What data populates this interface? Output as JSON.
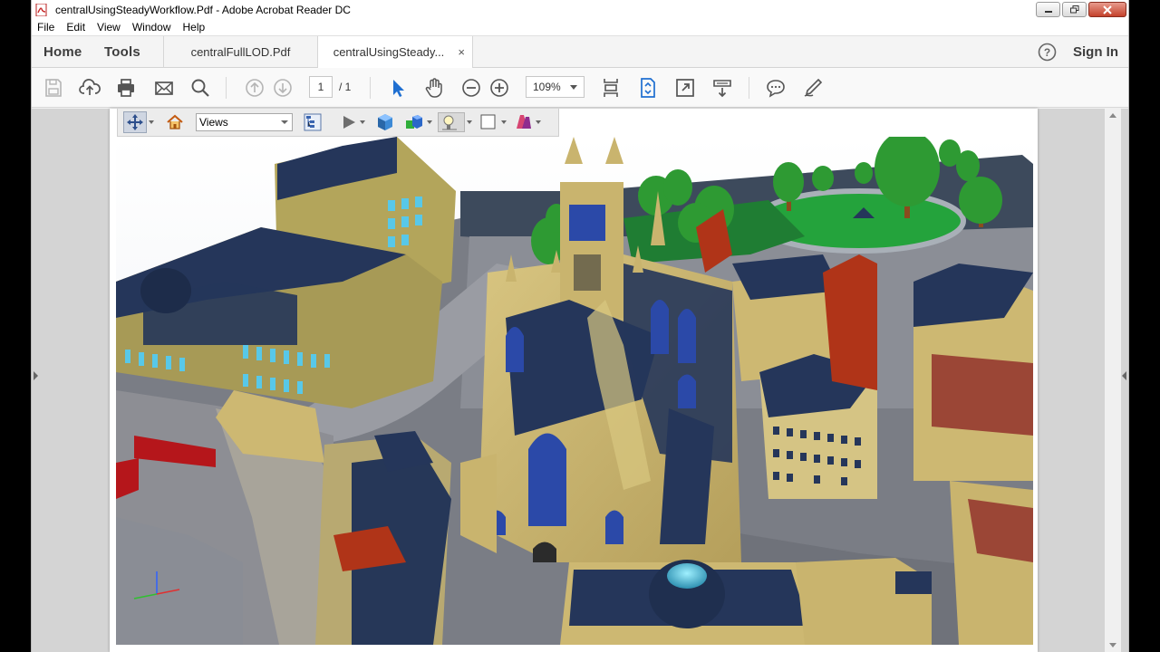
{
  "window": {
    "title": "centralUsingSteadyWorkflow.Pdf - Adobe Acrobat Reader DC"
  },
  "menu": [
    "File",
    "Edit",
    "View",
    "Window",
    "Help"
  ],
  "tabbar": {
    "home": "Home",
    "tools": "Tools",
    "tabs": [
      {
        "label": "centralFullLOD.Pdf"
      },
      {
        "label": "centralUsingSteady...",
        "close": "×"
      }
    ],
    "signin": "Sign In"
  },
  "toolbar": {
    "page_current": "1",
    "page_total": "/ 1",
    "zoom": "109%"
  },
  "toolbar3d": {
    "views_label": "Views"
  },
  "colors": {
    "stone": "#cdb872",
    "roof_navy": "#25365a",
    "glass_blue": "#2b49a8",
    "grass": "#1f7d33",
    "road": "#6c6f78",
    "sky": "#f4f6f8"
  }
}
